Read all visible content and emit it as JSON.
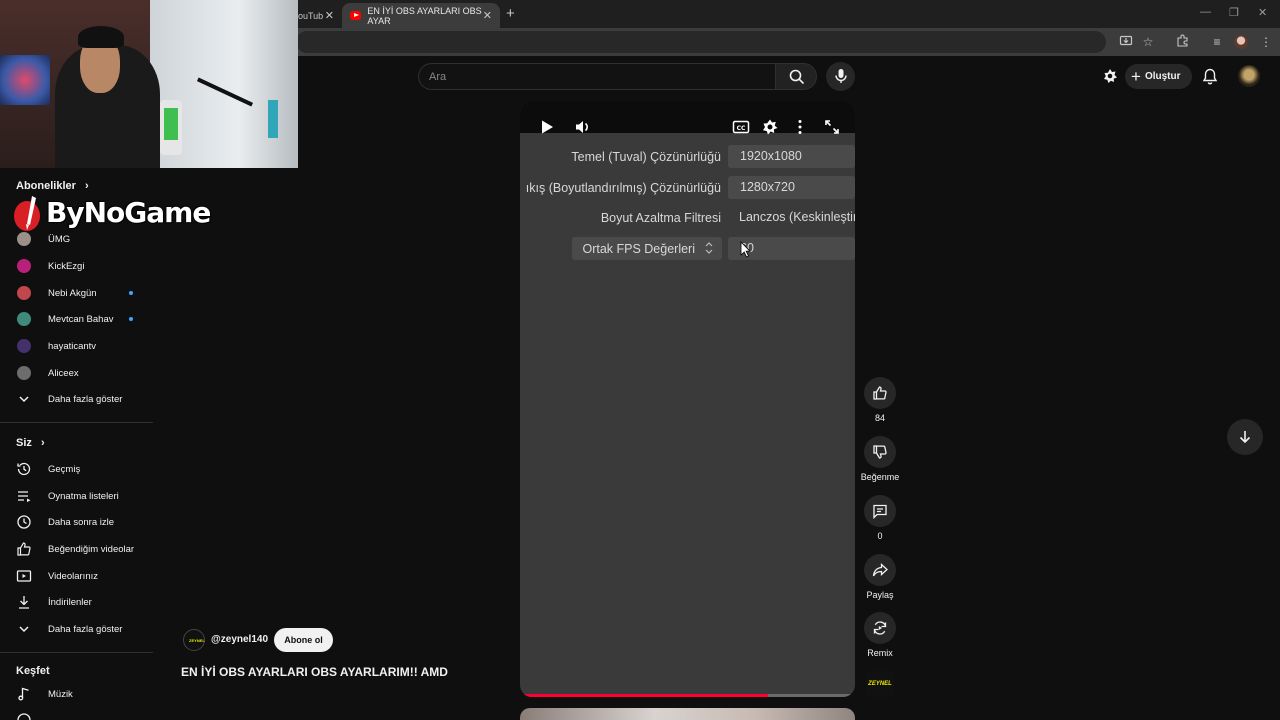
{
  "browser": {
    "tabs": [
      {
        "label": "ouTub",
        "active": false
      },
      {
        "label": "EN İYİ OBS AYARLARI OBS AYAR",
        "active": true
      }
    ]
  },
  "header": {
    "search_placeholder": "Ara",
    "create_label": "Oluştur"
  },
  "sidebar": {
    "subscriptions_title": "Abonelikler",
    "subscriptions": [
      {
        "label": "ÜMG",
        "live": false,
        "color": "#9c8f8a"
      },
      {
        "label": "KickEzgi",
        "live": false,
        "color": "#b8207a"
      },
      {
        "label": "Nebi Akgün",
        "live": true,
        "color": "#c2464e"
      },
      {
        "label": "Mevtcan Bahav",
        "live": true,
        "color": "#3f8a7a"
      },
      {
        "label": "hayaticantv",
        "live": false,
        "color": "#44306a"
      },
      {
        "label": "Aliceex",
        "live": false,
        "color": "#6d6d6d"
      }
    ],
    "show_more": "Daha fazla göster",
    "you_title": "Siz",
    "you_items": [
      {
        "label": "Geçmiş",
        "icon": "history-icon"
      },
      {
        "label": "Oynatma listeleri",
        "icon": "playlists-icon"
      },
      {
        "label": "Daha sonra izle",
        "icon": "watch-later-icon"
      },
      {
        "label": "Beğendiğim videolar",
        "icon": "liked-icon"
      },
      {
        "label": "Videolarınız",
        "icon": "your-videos-icon"
      },
      {
        "label": "İndirilenler",
        "icon": "downloads-icon"
      }
    ],
    "show_more_2": "Daha fazla göster",
    "explore_title": "Keşfet",
    "explore_items": [
      {
        "label": "Müzik",
        "icon": "music-icon"
      }
    ]
  },
  "overlay": {
    "logo_text": "ByNoGame"
  },
  "player": {
    "obs_rows": [
      {
        "label": "Temel (Tuval) Çözünürlüğü",
        "value": "1920x1080"
      },
      {
        "label": "ıkış (Boyutlandırılmış) Çözünürlüğü",
        "value": "1280x720"
      },
      {
        "label": "Boyut Azaltma Filtresi",
        "value": "Lanczos (Keskinleştir"
      },
      {
        "label": "Ortak FPS Değerleri",
        "value": "60"
      }
    ],
    "progress": 0.74
  },
  "video": {
    "channel": "@zeynel140",
    "subscribe_label": "Abone ol",
    "title": "EN İYİ OBS AYARLARI OBS AYARLARIM!! AMD",
    "channel_thumb_text": "ZEYNEL"
  },
  "actions": {
    "likes": "84",
    "dislike_label": "Beğenme",
    "comments": "0",
    "share_label": "Paylaş",
    "remix_label": "Remix"
  }
}
